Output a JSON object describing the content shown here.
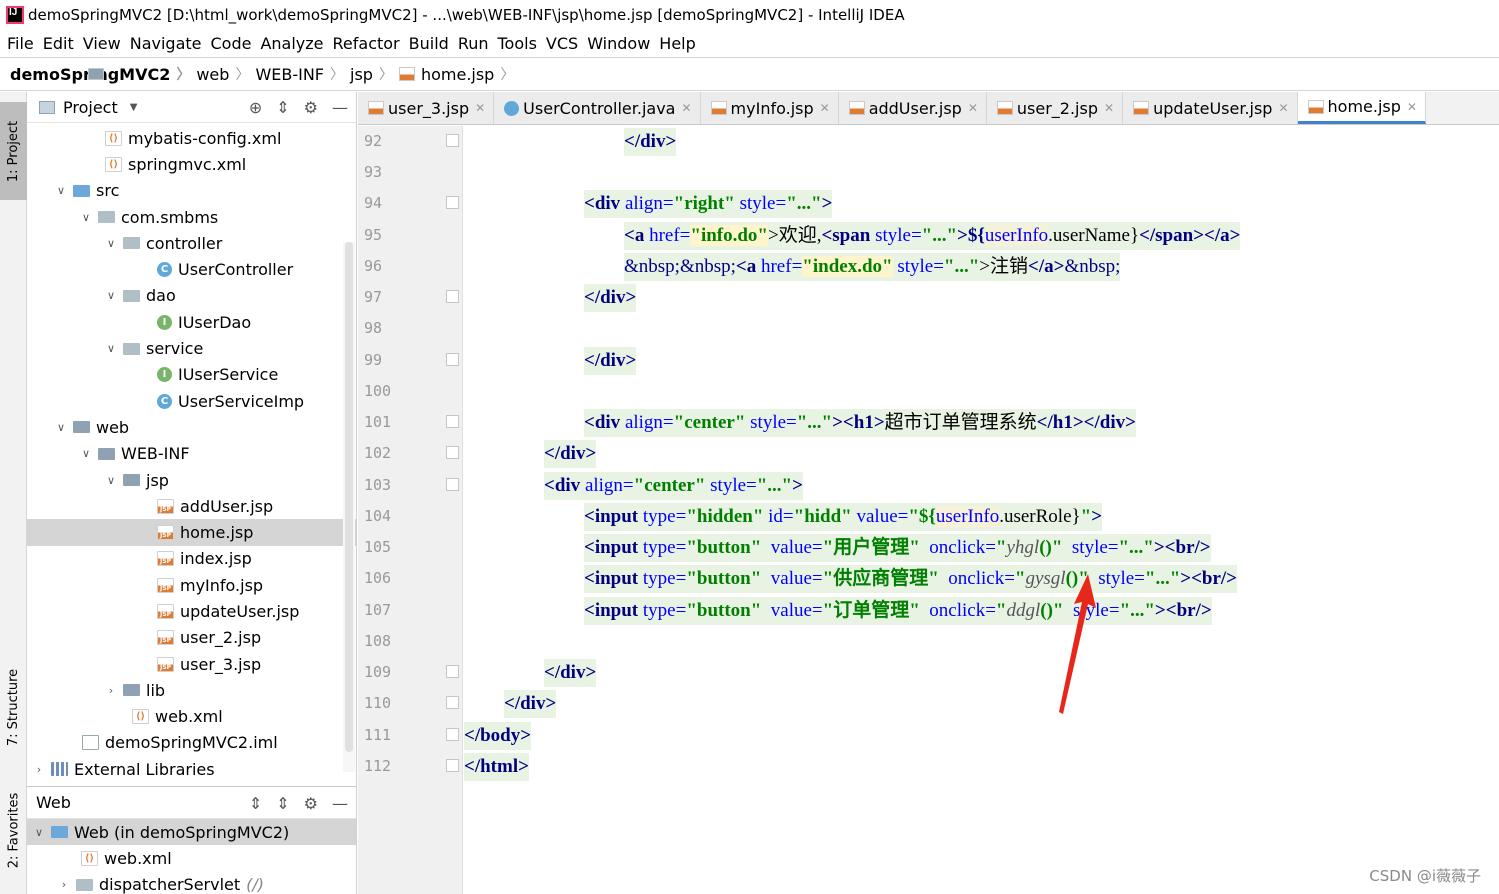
{
  "window": {
    "title": "demoSpringMVC2 [D:\\html_work\\demoSpringMVC2] - ...\\web\\WEB-INF\\jsp\\home.jsp [demoSpringMVC2] - IntelliJ IDEA"
  },
  "menu": [
    "File",
    "Edit",
    "View",
    "Navigate",
    "Code",
    "Analyze",
    "Refactor",
    "Build",
    "Run",
    "Tools",
    "VCS",
    "Window",
    "Help"
  ],
  "breadcrumb": [
    "demoSpringMVC2",
    "web",
    "WEB-INF",
    "jsp",
    "home.jsp"
  ],
  "left_tabs": {
    "project": "1: Project",
    "structure": "7: Structure",
    "favorites": "2: Favorites"
  },
  "project_panel": {
    "title": "Project",
    "items": [
      {
        "label": "mybatis-config.xml",
        "icon": "xml-file-icon"
      },
      {
        "label": "springmvc.xml",
        "icon": "xml-file-icon"
      },
      {
        "label": "src",
        "icon": "source-folder-icon"
      },
      {
        "label": "com.smbms",
        "icon": "package-icon"
      },
      {
        "label": "controller",
        "icon": "package-icon"
      },
      {
        "label": "UserController",
        "icon": "class-icon"
      },
      {
        "label": "dao",
        "icon": "package-icon"
      },
      {
        "label": "IUserDao",
        "icon": "interface-icon"
      },
      {
        "label": "service",
        "icon": "package-icon"
      },
      {
        "label": "IUserService",
        "icon": "interface-icon"
      },
      {
        "label": "UserServiceImp",
        "icon": "class-icon"
      },
      {
        "label": "web",
        "icon": "web-folder-icon"
      },
      {
        "label": "WEB-INF",
        "icon": "folder-icon"
      },
      {
        "label": "jsp",
        "icon": "folder-icon"
      },
      {
        "label": "addUser.jsp",
        "icon": "jsp-file-icon"
      },
      {
        "label": "home.jsp",
        "icon": "jsp-file-icon"
      },
      {
        "label": "index.jsp",
        "icon": "jsp-file-icon"
      },
      {
        "label": "myInfo.jsp",
        "icon": "jsp-file-icon"
      },
      {
        "label": "updateUser.jsp",
        "icon": "jsp-file-icon"
      },
      {
        "label": "user_2.jsp",
        "icon": "jsp-file-icon"
      },
      {
        "label": "user_3.jsp",
        "icon": "jsp-file-icon"
      },
      {
        "label": "lib",
        "icon": "folder-icon"
      },
      {
        "label": "web.xml",
        "icon": "xml-file-icon"
      },
      {
        "label": "demoSpringMVC2.iml",
        "icon": "iml-file-icon"
      },
      {
        "label": "External Libraries",
        "icon": "library-icon"
      }
    ]
  },
  "web_panel": {
    "title": "Web",
    "items": [
      {
        "label": "Web (in demoSpringMVC2)"
      },
      {
        "label": "web.xml"
      },
      {
        "label": "dispatcherServlet",
        "suffix": "(/)"
      }
    ]
  },
  "editor_tabs": [
    {
      "label": "user_3.jsp",
      "icon": "jsp-file-icon"
    },
    {
      "label": "UserController.java",
      "icon": "class-icon"
    },
    {
      "label": "myInfo.jsp",
      "icon": "jsp-file-icon"
    },
    {
      "label": "addUser.jsp",
      "icon": "jsp-file-icon"
    },
    {
      "label": "user_2.jsp",
      "icon": "jsp-file-icon"
    },
    {
      "label": "updateUser.jsp",
      "icon": "jsp-file-icon"
    },
    {
      "label": "home.jsp",
      "icon": "jsp-file-icon",
      "active": true
    }
  ],
  "line_numbers": [
    "92",
    "93",
    "94",
    "95",
    "96",
    "97",
    "98",
    "99",
    "100",
    "101",
    "102",
    "103",
    "104",
    "105",
    "106",
    "107",
    "108",
    "109",
    "110",
    "111",
    "112"
  ],
  "code": {
    "l92": [
      "</div>"
    ],
    "l94": [
      "<div",
      " align=",
      "\"right\"",
      " style=",
      "\"...\"",
      ">"
    ],
    "l95": [
      "<a",
      " href=",
      "\"info.do\"",
      ">欢迎,",
      "<span",
      " style=",
      "\"...\"",
      ">${",
      "userInfo",
      ".userName}",
      "</span>",
      "</a>"
    ],
    "l96": [
      "&nbsp;&nbsp;",
      "<a",
      " href=",
      "\"index.do\"",
      " style=",
      "\"...\"",
      ">注销",
      "</a>",
      "&nbsp;"
    ],
    "l97": [
      "</div>"
    ],
    "l99": [
      "</div>"
    ],
    "l101": [
      "<div",
      " align=",
      "\"center\"",
      " style=",
      "\"...\"",
      "><h1>",
      "超市订单管理系统",
      "</h1></div>"
    ],
    "l102": [
      "</div>"
    ],
    "l103": [
      "<div",
      " align=",
      "\"center\"",
      " style=",
      "\"...\"",
      ">"
    ],
    "l104": [
      "<input",
      " type=",
      "\"hidden\"",
      " id=",
      "\"hidd\"",
      " value=",
      "\"${",
      "userInfo",
      ".userRole}",
      "\"",
      ">"
    ],
    "l105": [
      "<input",
      " type=",
      "\"button\"",
      "  value=",
      "\"用户管理\"",
      "  onclick=",
      "\"",
      "yhgl",
      "()\"",
      "  style=",
      "\"...\"",
      "><br/>"
    ],
    "l106": [
      "<input",
      " type=",
      "\"button\"",
      "  value=",
      "\"供应商管理\"",
      "  onclick=",
      "\"",
      "gysgl",
      "()\"",
      "  style=",
      "\"...\"",
      "><br/>"
    ],
    "l107": [
      "<input",
      " type=",
      "\"button\"",
      "  value=",
      "\"订单管理\"",
      "  onclick=",
      "\"",
      "ddgl",
      "()\"",
      "  style=",
      "\"...\"",
      "><br/>"
    ],
    "l109": [
      "</div>"
    ],
    "l110": [
      "</div>"
    ],
    "l111": [
      "</body>"
    ],
    "l112": [
      "</html>"
    ]
  },
  "watermark": "CSDN @i薇薇子",
  "colors": {
    "tag": "#000080",
    "attr": "#0000ff",
    "string": "#008000",
    "annotation_arrow": "#e8271c",
    "active_tab": "#4083c9"
  }
}
